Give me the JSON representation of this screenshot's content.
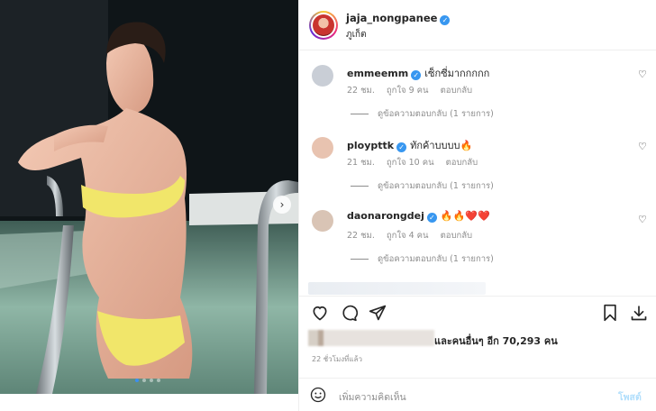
{
  "post": {
    "username": "jaja_nongpanee",
    "location": "ภูเก็ต",
    "photo_index": 1,
    "photo_count": 4
  },
  "comments": [
    {
      "username": "emmeemm",
      "text": "เซ็กซี่มากกกกก",
      "age": "22 ชม.",
      "likes": "ถูกใจ 9 คน",
      "reply": "ตอบกลับ",
      "view_replies": "ดูข้อความตอบกลับ (1 รายการ)",
      "avatar_color": "#c9ced6"
    },
    {
      "username": "ploypttk",
      "text": "ทักค้าบบบบ🔥",
      "age": "21 ชม.",
      "likes": "ถูกใจ 10 คน",
      "reply": "ตอบกลับ",
      "view_replies": "ดูข้อความตอบกลับ (1 รายการ)",
      "avatar_color": "#e8c3b0"
    },
    {
      "username": "daonarongdej",
      "text": "🔥🔥❤️❤️",
      "age": "22 ชม.",
      "likes": "ถูกใจ 4 คน",
      "reply": "ตอบกลับ",
      "view_replies": "ดูข้อความตอบกลับ (1 รายการ)",
      "avatar_color": "#d9c4b5"
    }
  ],
  "likes_text": "และคนอื่นๆ อีก 70,293 คน",
  "posted_ago": "22 ชั่วโมงที่แล้ว",
  "composer": {
    "placeholder": "เพิ่มความคิดเห็น",
    "post_label": "โพสต์"
  },
  "colors": {
    "verified": "#3897f0",
    "post_disabled": "#b2dffc",
    "secondary_text": "#8e8e8e"
  }
}
